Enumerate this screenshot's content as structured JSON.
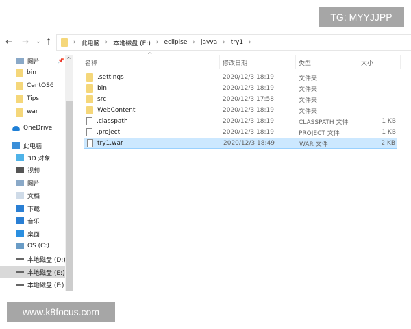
{
  "watermarks": {
    "top": "TG: MYYJJPP",
    "bottom": "www.k8focus.com"
  },
  "toolbar": {
    "back": "←",
    "forward": "→",
    "recent": "⌄",
    "up": "↑"
  },
  "breadcrumb": [
    "此电脑",
    "本地磁盘 (E:)",
    "eclipise",
    "javva",
    "try1"
  ],
  "nav": [
    {
      "label": "图片",
      "icon": "pictures-icon",
      "pinned": true
    },
    {
      "label": "bin",
      "icon": "folder-icon"
    },
    {
      "label": "CentOS6",
      "icon": "folder-icon"
    },
    {
      "label": "Tips",
      "icon": "folder-icon"
    },
    {
      "label": "war",
      "icon": "folder-icon"
    },
    {
      "label": "OneDrive",
      "icon": "cloud-icon"
    },
    {
      "label": "此电脑",
      "icon": "computer-icon"
    },
    {
      "label": "3D 对象",
      "icon": "3d-objects-icon"
    },
    {
      "label": "视频",
      "icon": "video-icon"
    },
    {
      "label": "图片",
      "icon": "pictures-icon"
    },
    {
      "label": "文档",
      "icon": "document-icon"
    },
    {
      "label": "下载",
      "icon": "download-icon"
    },
    {
      "label": "音乐",
      "icon": "music-icon"
    },
    {
      "label": "桌面",
      "icon": "desktop-icon"
    },
    {
      "label": "OS (C:)",
      "icon": "os-drive-icon"
    },
    {
      "label": "本地磁盘 (D:)",
      "icon": "drive-icon"
    },
    {
      "label": "本地磁盘 (E:)",
      "icon": "drive-icon",
      "selected": true
    },
    {
      "label": "本地磁盘 (F:)",
      "icon": "drive-icon"
    }
  ],
  "columns": {
    "name": "名称",
    "date": "修改日期",
    "type": "类型",
    "size": "大小"
  },
  "files": [
    {
      "name": ".settings",
      "date": "2020/12/3 18:19",
      "type": "文件夹",
      "size": "",
      "folder": true
    },
    {
      "name": "bin",
      "date": "2020/12/3 18:19",
      "type": "文件夹",
      "size": "",
      "folder": true
    },
    {
      "name": "src",
      "date": "2020/12/3 17:58",
      "type": "文件夹",
      "size": "",
      "folder": true
    },
    {
      "name": "WebContent",
      "date": "2020/12/3 18:19",
      "type": "文件夹",
      "size": "",
      "folder": true
    },
    {
      "name": ".classpath",
      "date": "2020/12/3 18:19",
      "type": "CLASSPATH 文件",
      "size": "1 KB"
    },
    {
      "name": ".project",
      "date": "2020/12/3 18:19",
      "type": "PROJECT 文件",
      "size": "1 KB"
    },
    {
      "name": "try1.war",
      "date": "2020/12/3 18:49",
      "type": "WAR 文件",
      "size": "2 KB",
      "selected": true
    }
  ],
  "colors": {
    "folder": "#f5d77a",
    "selection": "#cce8ff",
    "accent": "#1e7fd6"
  }
}
